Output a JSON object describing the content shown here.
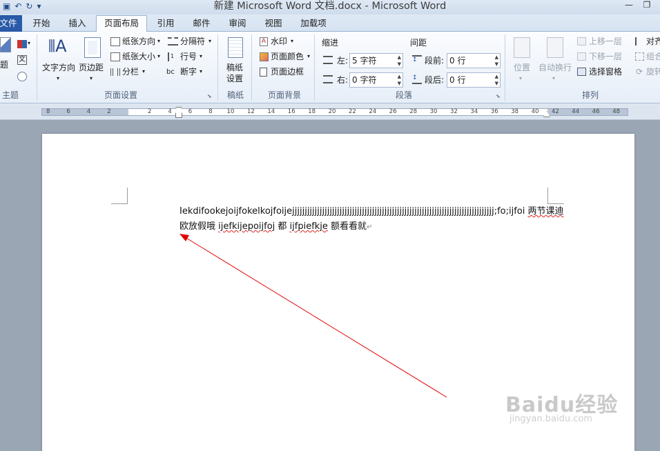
{
  "window": {
    "title": "新建 Microsoft Word 文档.docx - Microsoft Word"
  },
  "tabs": [
    "文件",
    "开始",
    "插入",
    "页面布局",
    "引用",
    "邮件",
    "审阅",
    "视图",
    "加载项"
  ],
  "active_tab": "页面布局",
  "ribbon": {
    "theme": {
      "top_label": "",
      "side_label": "题",
      "group": "主题"
    },
    "page_setup": {
      "group": "页面设置",
      "text_direction": "文字方向",
      "margins": "页边距",
      "orientation": "纸张方向",
      "size": "纸张大小",
      "columns": "分栏",
      "breaks": "分隔符",
      "line_numbers": "行号",
      "hyphenation": "断字"
    },
    "manuscript": {
      "group": "稿纸",
      "btn_line1": "稿纸",
      "btn_line2": "设置"
    },
    "page_background": {
      "group": "页面背景",
      "watermark": "水印",
      "page_color": "页面颜色",
      "page_borders": "页面边框"
    },
    "paragraph": {
      "group": "段落",
      "indent": "缩进",
      "spacing": "间距",
      "left_label": "左:",
      "left_value": "5 字符",
      "right_label": "右:",
      "right_value": "0 字符",
      "before_label": "段前:",
      "before_value": "0 行",
      "after_label": "段后:",
      "after_value": "0 行"
    },
    "arrange": {
      "group": "排列",
      "position": "位置",
      "wrap": "自动换行",
      "bring_forward": "上移一层",
      "send_backward": "下移一层",
      "selection_pane": "选择窗格",
      "align": "对齐",
      "group_btn": "组合",
      "rotate": "旋转"
    }
  },
  "ruler": {
    "ticks": [
      "8",
      "6",
      "4",
      "2",
      "",
      "2",
      "4",
      "6",
      "8",
      "10",
      "12",
      "14",
      "16",
      "18",
      "20",
      "22",
      "24",
      "26",
      "28",
      "30",
      "32",
      "34",
      "36",
      "38",
      "40",
      "42",
      "44",
      "46",
      "48"
    ]
  },
  "document": {
    "line1_a": "Iekdifookejoijfokelkojfoijejjjjjjjjjjjjjjjjjjjjjjjjjjjjjjjjjjjjjjjjjjjjjjjjjjjjjjjjjjjjjjjjjjjjjjjjjjjjjjjjj;fo;ijfoi ",
    "line1_b": "两节课迪",
    "line2_a": "欧放假哦 ",
    "line2_b": "ijefkijepoijfoj",
    "line2_c": " 都 ",
    "line2_d": "ijfpiefkje",
    "line2_e": " 额看看就",
    "para_mark": "↵"
  },
  "watermark": {
    "brand": "Baidu经验",
    "url": "jingyan.baidu.com"
  },
  "colors": {
    "arrow": "#e00000",
    "file_tab": "#2a5aa8"
  }
}
